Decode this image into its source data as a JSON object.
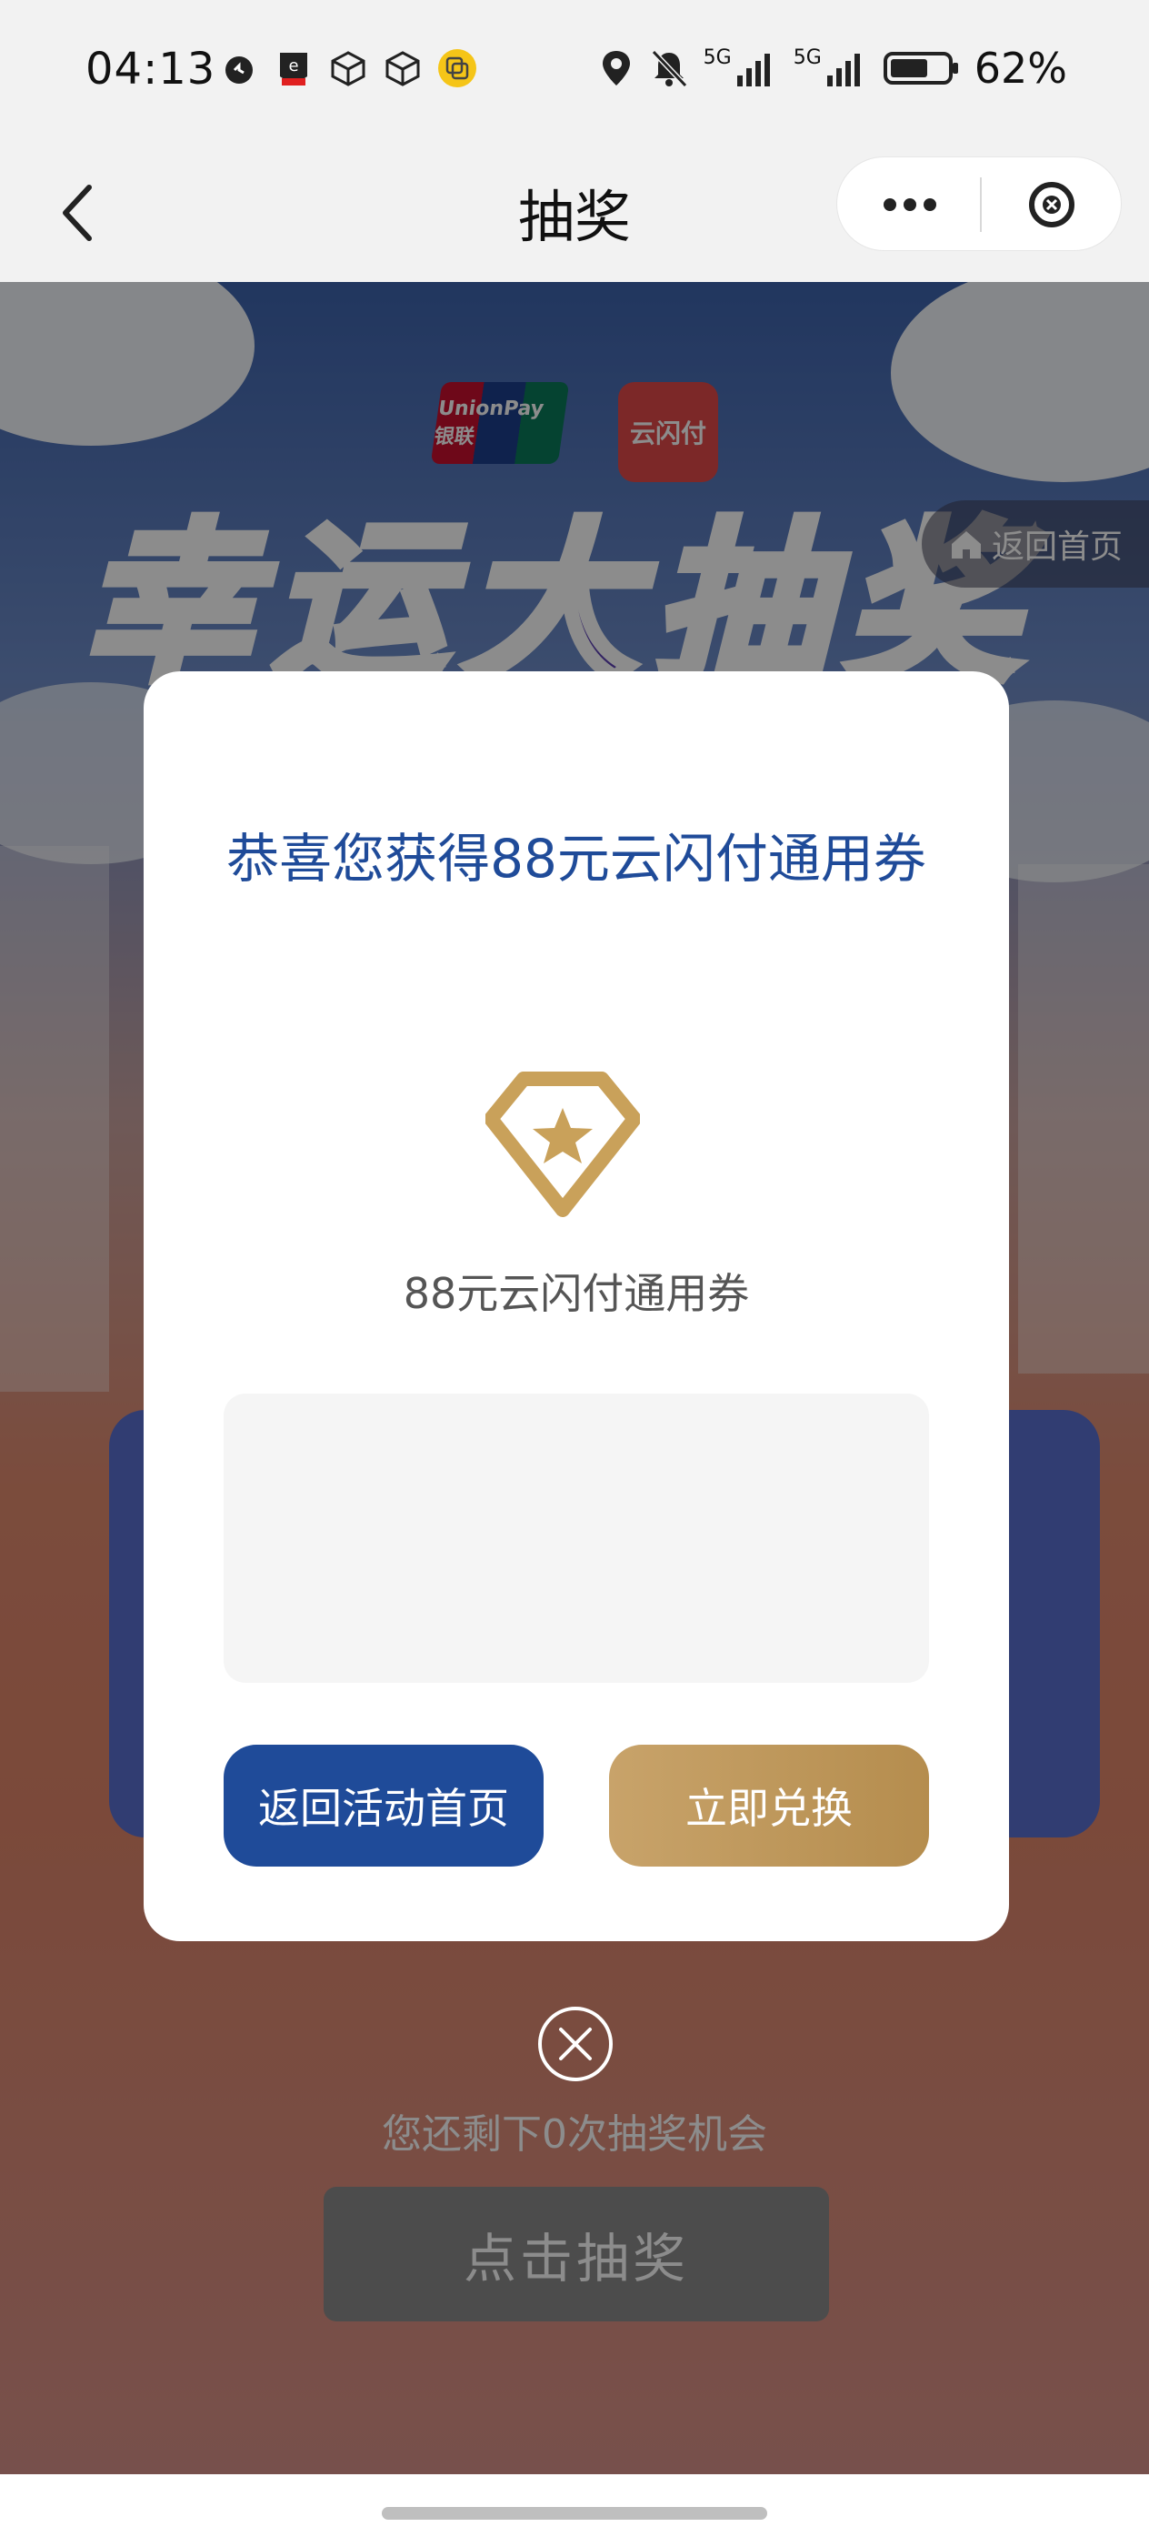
{
  "status_bar": {
    "time": "04:13",
    "network_1": "5G",
    "network_2": "5G",
    "battery": "62%"
  },
  "nav": {
    "title": "抽奖"
  },
  "background": {
    "headline": "幸运大抽奖",
    "logo_unionpay": "UnionPay 银联",
    "logo_yunshanfu": "云闪付",
    "home_chip": "返回首页",
    "remaining_text": "您还剩下0次抽奖机会",
    "draw_button": "点击抽奖"
  },
  "modal": {
    "title": "恭喜您获得88元云闪付通用券",
    "prize_name": "88元云闪付通用券",
    "back_button": "返回活动首页",
    "redeem_button": "立即兑换"
  },
  "colors": {
    "primary_blue": "#1f4b99",
    "gold": "#c8a36a"
  }
}
